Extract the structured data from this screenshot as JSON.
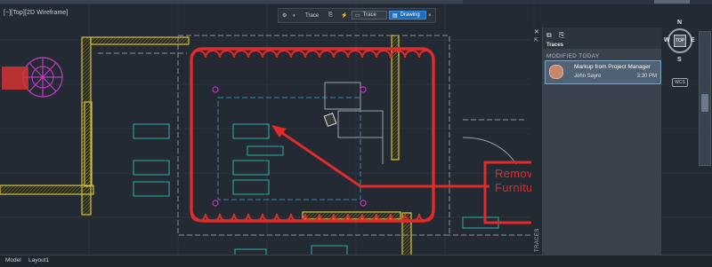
{
  "viewport": {
    "label": "[−][Top][2D Wireframe]"
  },
  "tracebar": {
    "trace_label": "Trace",
    "trace_button": "Trace",
    "drawing_button": "Drawing",
    "close_label": "×"
  },
  "panel": {
    "title": "Traces",
    "section": "MODIFIED TODAY",
    "card": {
      "title": "Markup from Project Manager",
      "user": "John Sayre",
      "time": "3:30 PM"
    },
    "side_label": "TRACES",
    "close_label": "✕"
  },
  "navcube": {
    "n": "N",
    "e": "E",
    "s": "S",
    "w": "W",
    "top": "TOP",
    "wcs": "WCS"
  },
  "markup": {
    "line1": "Remov",
    "line2": "Furnitu"
  },
  "statusbar": {
    "tab1": "Model",
    "tab2": "Layout1"
  },
  "colors": {
    "background": "#232a33",
    "markup_red": "#e02b2b",
    "wall_yellow": "#d6c23a",
    "furniture_teal": "#2fa39a",
    "door_magenta": "#c03ac2",
    "accent_blue": "#1f6fb8"
  }
}
